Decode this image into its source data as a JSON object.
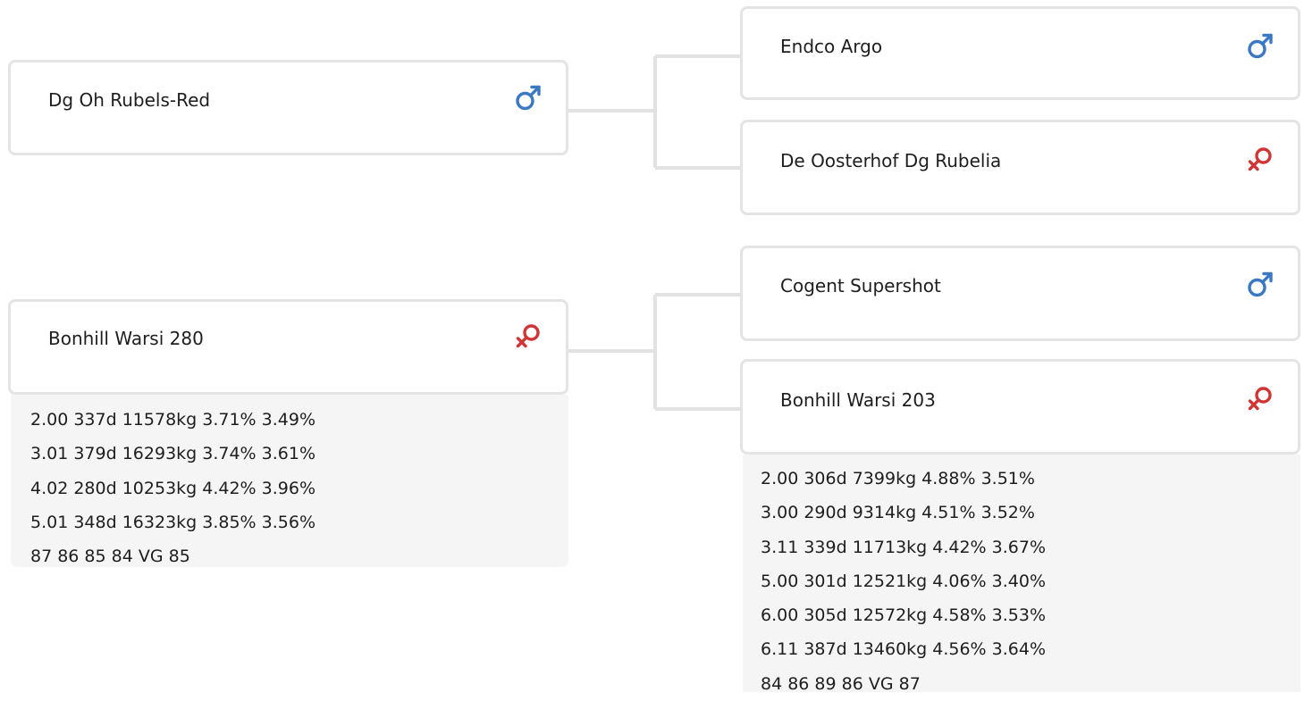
{
  "colors": {
    "male": "#3a78c2",
    "female": "#cf3535",
    "card_border": "#e4e4e4",
    "info_background": "#f5f5f5",
    "connector": "#e2e2e2"
  },
  "pedigree": {
    "sire": {
      "name": "Dg Oh Rubels-Red",
      "sex": "male",
      "icon": "male-symbol-icon",
      "parents": {
        "sire": {
          "name": "Endco Argo",
          "sex": "male",
          "icon": "male-symbol-icon"
        },
        "dam": {
          "name": "De Oosterhof Dg Rubelia",
          "sex": "female",
          "icon": "female-symbol-icon"
        }
      }
    },
    "dam": {
      "name": "Bonhill Warsi 280",
      "sex": "female",
      "icon": "female-symbol-icon",
      "records": [
        "2.00 337d 11578kg 3.71% 3.49%",
        "3.01 379d 16293kg 3.74% 3.61%",
        "4.02 280d 10253kg 4.42% 3.96%",
        "5.01 348d 16323kg 3.85% 3.56%",
        "87 86 85 84 VG 85"
      ],
      "parents": {
        "sire": {
          "name": "Cogent Supershot",
          "sex": "male",
          "icon": "male-symbol-icon"
        },
        "dam": {
          "name": "Bonhill Warsi 203",
          "sex": "female",
          "icon": "female-symbol-icon",
          "records": [
            "2.00 306d 7399kg 4.88% 3.51%",
            "3.00 290d 9314kg 4.51% 3.52%",
            "3.11 339d 11713kg 4.42% 3.67%",
            "5.00 301d 12521kg 4.06% 3.40%",
            "6.00 305d 12572kg 4.58% 3.53%",
            "6.11 387d 13460kg 4.56% 3.64%",
            "84 86 89 86 VG 87"
          ]
        }
      }
    }
  }
}
